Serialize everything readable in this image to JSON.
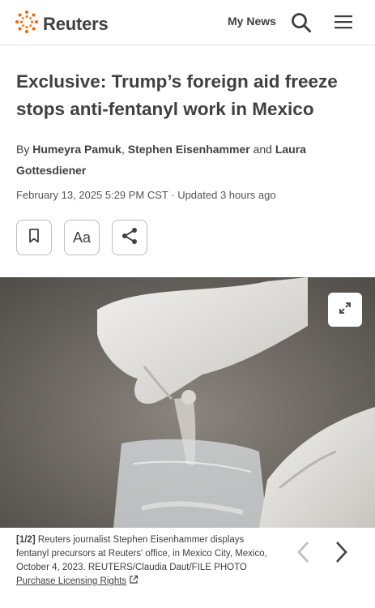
{
  "header": {
    "logo_text": "Reuters",
    "my_news": "My News",
    "icons": [
      "reuters-logo-icon",
      "search-icon",
      "hamburger-menu-icon"
    ]
  },
  "article": {
    "headline": "Exclusive: Trump’s foreign aid freeze stops anti-fentanyl work in Mexico",
    "byline": {
      "prefix": "By",
      "author1": "Humeyra Pamuk",
      "sep1": ",",
      "author2": "Stephen Eisenhammer",
      "and": "and",
      "author3": "Laura Gottesdiener"
    },
    "dateline": "February 13, 2025 5:29 PM CST · Updated 3 hours ago"
  },
  "toolbar": {
    "font_label": "Aa",
    "icons": [
      "bookmark-icon",
      "share-icon"
    ]
  },
  "photo": {
    "counter": "[1/2]",
    "caption": "Reuters journalist Stephen Eisenhammer displays fentanyl precursors at Reuters' office, in Mexico City, Mexico, October 4, 2023. REUTERS/Claudia Daut/FILE PHOTO",
    "license_link": "Purchase Licensing Rights",
    "icons": [
      "expand-icon",
      "external-link-icon",
      "prev-arrow-icon",
      "next-arrow-icon"
    ]
  },
  "colors": {
    "text": "#404040",
    "accent": "#fa6400",
    "border": "#bdbdbd"
  }
}
